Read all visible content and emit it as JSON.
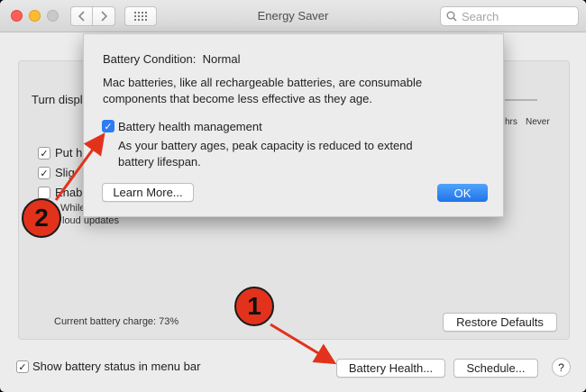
{
  "window": {
    "title": "Energy Saver"
  },
  "toolbar": {
    "search_placeholder": "Search"
  },
  "main": {
    "turn_display_label": "Turn displ",
    "slider_ticks": [
      "hrs",
      "Never"
    ],
    "options": [
      {
        "label": "Put h",
        "checked": true
      },
      {
        "label": "Slig",
        "checked": true
      },
      {
        "label": "Enab",
        "checked": false
      }
    ],
    "enable_note_partial": "While",
    "enable_note_cloud": "loud updates",
    "current_charge": "Current battery charge: 73%",
    "restore_defaults": "Restore Defaults",
    "show_status_label": "Show battery status in menu bar",
    "show_status_checked": true,
    "battery_health_button": "Battery Health...",
    "schedule_button": "Schedule...",
    "help_label": "?"
  },
  "sheet": {
    "condition_label": "Battery Condition:",
    "condition_value": "Normal",
    "description": "Mac batteries, like all rechargeable batteries, are consumable components that become less effective as they age.",
    "management_label": "Battery health management",
    "management_checked": true,
    "management_description": "As your battery ages, peak capacity is reduced to extend battery lifespan.",
    "learn_more": "Learn More...",
    "ok": "OK"
  },
  "annotations": {
    "badge1": "1",
    "badge2": "2",
    "color": "#e2321c"
  }
}
